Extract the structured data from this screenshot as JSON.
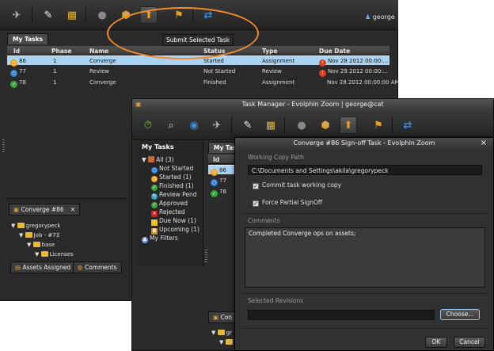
{
  "back_window": {
    "user": "george",
    "tooltip": "Submit Selected Task",
    "tab_label": "My Tasks",
    "columns": [
      "Id",
      "Phase",
      "Name",
      "Status",
      "Type",
      "Due Date"
    ],
    "rows": [
      {
        "id": "86",
        "phase": "1",
        "name": "Converge",
        "status": "Started",
        "type": "Assignment",
        "due": "Nov 28 2012 00:00:..."
      },
      {
        "id": "77",
        "phase": "1",
        "name": "Review",
        "status": "Not Started",
        "type": "Review",
        "due": "Nov 29 2012 00:00:..."
      },
      {
        "id": "78",
        "phase": "1",
        "name": "Converge",
        "status": "Finished",
        "type": "Assignment",
        "due": "Nov 28 2012 00:00:00 AM"
      }
    ],
    "detail_tab": "Converge #86",
    "tree": [
      "gregorypeck",
      "Job - #73",
      "base",
      "Licenses"
    ],
    "bottom_tabs": [
      "Assets Assigned",
      "Comments"
    ]
  },
  "front_window": {
    "title": "Task Manager - Evolphin Zoom | george@cat",
    "sidebar_title": "My Tasks",
    "filters": [
      "All (3)",
      "Not Started",
      "Started (1)",
      "Finished (1)",
      "Review Pend",
      "Approved",
      "Rejected",
      "Due Now (1)",
      "Upcoming (1)",
      "My Filters"
    ],
    "tab_label": "My Tasks",
    "col_id": "Id",
    "ids": [
      "86",
      "77",
      "78"
    ],
    "bottom_tab": "Con",
    "bottom_tree_partial": "gr"
  },
  "dialog": {
    "title": "Converge #86 Sign-off Task - Evolphin Zoom",
    "close": "×",
    "working_copy_label": "Working Copy Path",
    "working_copy_path": "C:\\Documents and Settings\\akila\\gregorypeck",
    "commit_label": "Commit task working copy",
    "force_label": "Force Partial SignOff",
    "comments_label": "Comments",
    "comments_text": "Completed Converge ops on assets;",
    "revisions_label": "Selected Revisions",
    "choose_button": "Choose...",
    "ok_button": "OK",
    "cancel_button": "Cancel"
  },
  "colors": {
    "accent_orange": "#f08a2c",
    "selection_blue": "#a8d3f3",
    "panel_dark": "#2b2b2b"
  }
}
